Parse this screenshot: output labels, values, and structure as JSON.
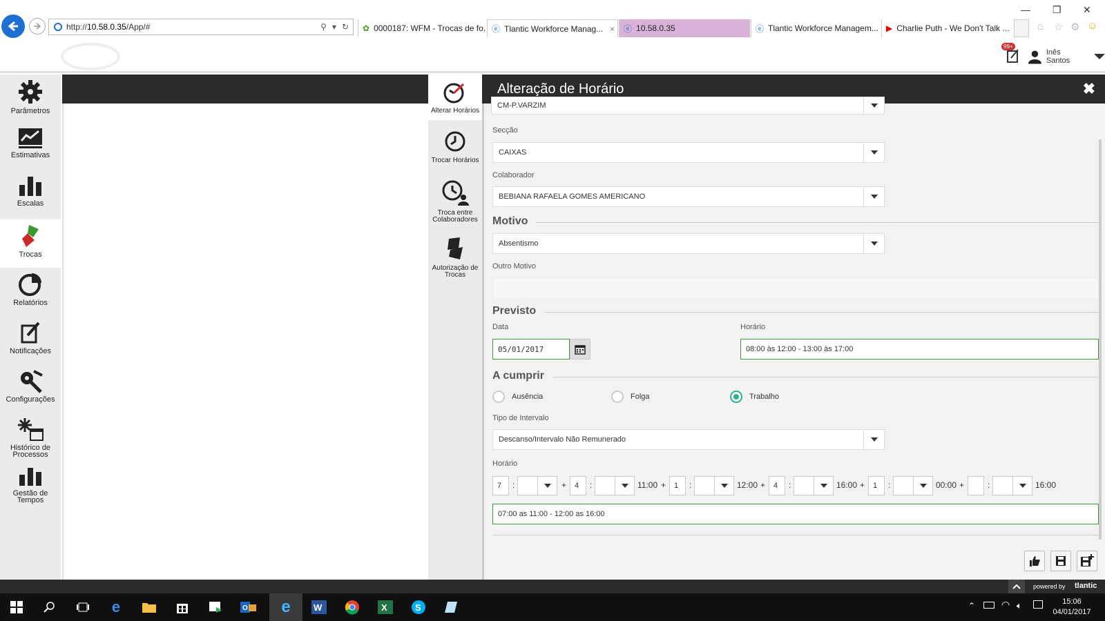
{
  "browser": {
    "url_prefix": "http://",
    "url_host": "10.58.0.35",
    "url_path": "/App/#",
    "tabs": [
      {
        "label": "0000187: WFM - Trocas de fo...",
        "active": false
      },
      {
        "label": "Tlantic Workforce Manag...",
        "active": true
      },
      {
        "label": "10.58.0.35",
        "active": false
      },
      {
        "label": "Tlantic Workforce Managem...",
        "active": false
      },
      {
        "label": "Charlie Puth - We Don't Talk ...",
        "active": false
      }
    ],
    "window_controls": {
      "minimize": "—",
      "restore": "❐",
      "close": "✕"
    }
  },
  "header": {
    "notification_count": "99+",
    "user_name": "Inês Santos"
  },
  "sidebar": {
    "items": [
      {
        "label": "Parâmetros",
        "icon": "gear-icon"
      },
      {
        "label": "Estimativas",
        "icon": "chart-icon"
      },
      {
        "label": "Escalas",
        "icon": "bars-icon"
      },
      {
        "label": "Trocas",
        "icon": "swap-icon"
      },
      {
        "label": "Relatórios",
        "icon": "pie-icon"
      },
      {
        "label": "Notificações",
        "icon": "note-icon"
      },
      {
        "label": "Configurações",
        "icon": "tools-icon"
      },
      {
        "label": "Histórico de Processos",
        "icon": "history-icon"
      },
      {
        "label": "Gestão de Tempos",
        "icon": "time-bars-icon"
      }
    ],
    "active": "Trocas"
  },
  "submenu": {
    "items": [
      {
        "label": "Alterar Horários"
      },
      {
        "label": "Trocar Horários"
      },
      {
        "label": "Troca entre Colaboradores"
      },
      {
        "label": "Autorização de Trocas"
      }
    ]
  },
  "panel": {
    "title": "Alteração de Horário",
    "loja_value": "CM-P.VARZIM",
    "seccao_label": "Secção",
    "seccao_value": "CAIXAS",
    "colaborador_label": "Colaborador",
    "colaborador_value": "BEBIANA RAFAELA GOMES AMERICANO",
    "motivo_heading": "Motivo",
    "motivo_value": "Absentismo",
    "outro_motivo_label": "Outro Motivo",
    "outro_motivo_value": "",
    "previsto_heading": "Previsto",
    "data_label": "Data",
    "data_value": "05/01/2017",
    "horario_label": "Horário",
    "horario_previsto": "08:00 às 12:00 - 13:00 às 17:00",
    "cumprir_heading": "A cumprir",
    "radios": [
      {
        "label": "Ausência",
        "checked": false
      },
      {
        "label": "Folga",
        "checked": false
      },
      {
        "label": "Trabalho",
        "checked": true
      }
    ],
    "tipo_intervalo_label": "Tipo de Intervalo",
    "tipo_intervalo_value": "Descanso/Intervalo Não Remunerado",
    "horario2_label": "Horário",
    "horario_row": {
      "h1": "7",
      "colon": ":",
      "plus": "+",
      "d1": "4",
      "t1": "11:00",
      "d2": "1",
      "t2": "12:00",
      "d3": "4",
      "t3": "16:00",
      "d4": "1",
      "t4": "00:00",
      "d5": "",
      "t5": "16:00"
    },
    "horario_result": "07:00 as 11:00 - 12:00 as 16:00"
  },
  "footer": {
    "powered_by": "powered by",
    "brand": "tlantic"
  },
  "taskbar": {
    "time": "15:06",
    "date": "04/01/2017"
  }
}
